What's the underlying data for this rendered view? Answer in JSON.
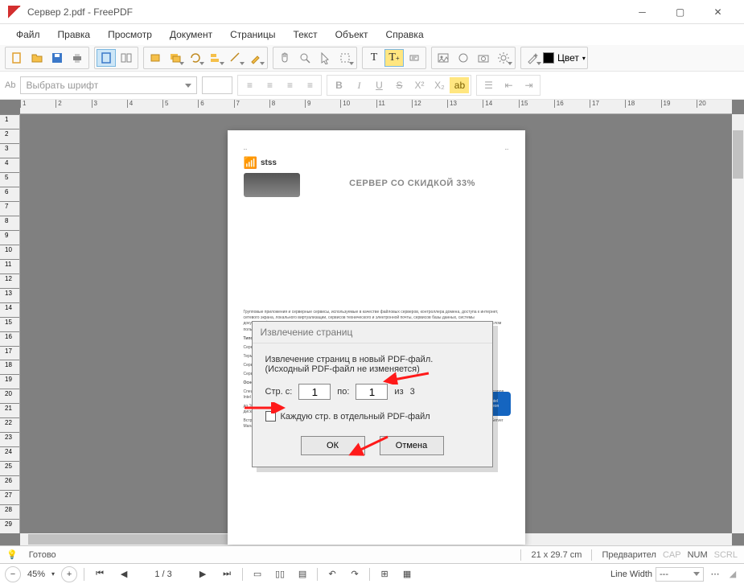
{
  "window": {
    "title": "Сервер 2.pdf - FreePDF"
  },
  "menu": [
    "Файл",
    "Правка",
    "Просмотр",
    "Документ",
    "Страницы",
    "Текст",
    "Объект",
    "Справка"
  ],
  "toolbar_color_label": "Цвет",
  "fontbar": {
    "placeholder": "Выбрать шрифт",
    "ab": "Ab",
    "b": "B",
    "i": "I",
    "u": "U",
    "s": "S",
    "sup": "X²",
    "sub": "X₂",
    "ab2": "ab"
  },
  "ruler_h": [
    "1",
    "2",
    "3",
    "4",
    "5",
    "6",
    "7",
    "8",
    "9",
    "10",
    "11",
    "12",
    "13",
    "14",
    "15",
    "16",
    "17",
    "18",
    "19",
    "20"
  ],
  "ruler_v": [
    "1",
    "2",
    "3",
    "4",
    "5",
    "6",
    "7",
    "8",
    "9",
    "10",
    "11",
    "12",
    "13",
    "14",
    "15",
    "16",
    "17",
    "18",
    "19",
    "20",
    "21",
    "22",
    "23",
    "24",
    "25",
    "26",
    "27",
    "28",
    "29"
  ],
  "page": {
    "brand": "stss",
    "heading": "СЕРВЕР СО СКИДКОЙ 33%",
    "intel_top": "intel",
    "intel_bottom": "Xeon",
    "para1": "Типовые задачи:",
    "para2": "Сервер баз данных (СУБД)",
    "para3": "Терминальный сервер (с количеством подключений 50+)",
    "para4": "Сервер электронной почты",
    "para5": "Сервер \"1С: Предприятие\" 7/8/8.x",
    "para6": "Основные характеристики:",
    "link": "сервера 1С: MS SQL + Предприятие 7.7/8.x"
  },
  "dialog": {
    "title": "Извлечение страниц",
    "line1": "Извлечение страниц в новый PDF-файл.",
    "line2": "(Исходный PDF-файл не изменяется)",
    "from_label": "Стр. с:",
    "from_value": "1",
    "to_label": "по:",
    "to_value": "1",
    "of_label": "из",
    "total": "3",
    "checkbox": "Каждую стр. в отдельный PDF-файл",
    "ok": "ОК",
    "cancel": "Отмена"
  },
  "status": {
    "ready": "Готово",
    "dims": "21 x 29.7 cm",
    "preview": "Предварител",
    "cap": "CAP",
    "num": "NUM",
    "scrl": "SCRL"
  },
  "bottom": {
    "zoom": "45%",
    "page": "1 / 3",
    "linewidth_label": "Line Width",
    "linewidth_value": "---"
  }
}
